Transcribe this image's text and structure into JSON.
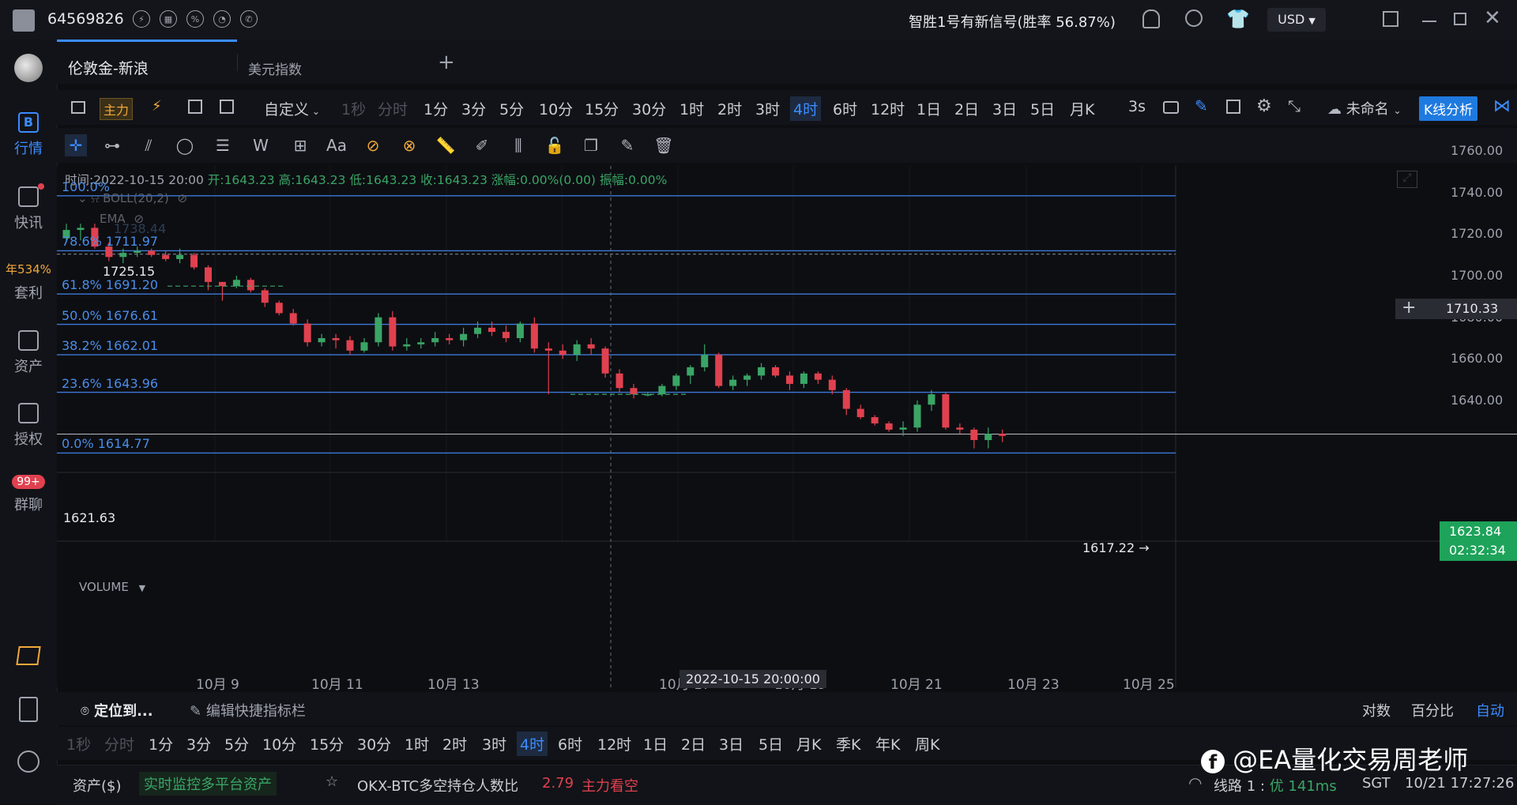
{
  "topbar": {
    "account_id": "64569826",
    "signal_text": "智胜1号有新信号(胜率 56.87%)",
    "currency": "USD"
  },
  "sidebar": {
    "items": [
      {
        "label": "行情",
        "icon": "b-icon"
      },
      {
        "label": "快讯",
        "icon": "news-icon"
      },
      {
        "label": "套利",
        "badge": "年534%"
      },
      {
        "label": "资产",
        "icon": "wallet-icon"
      },
      {
        "label": "授权",
        "icon": "key-icon"
      },
      {
        "label": "群聊",
        "badge": "99+"
      }
    ]
  },
  "tabs": [
    {
      "label": "伦敦金-新浪",
      "active": true
    },
    {
      "label": "美元指数",
      "active": false
    }
  ],
  "timeframe_bar": {
    "main_label": "主力",
    "custom_label": "自定义",
    "dim_items": [
      "1秒",
      "分时"
    ],
    "items": [
      "1分",
      "3分",
      "5分",
      "10分",
      "15分",
      "30分",
      "1时",
      "2时",
      "3时",
      "4时",
      "6时",
      "12时",
      "1日",
      "2日",
      "3日",
      "5日",
      "月K"
    ],
    "active": "4时",
    "refresh": "3s",
    "layout_name": "未命名",
    "kline_button": "K线分析"
  },
  "drawing_tools": {
    "text_tool": "Aa"
  },
  "chart_info": {
    "time": "时间:2022-10-15 20:00",
    "open": "开:1643.23",
    "high": "高:1643.23",
    "low": "低:1643.23",
    "close": "收:1643.23",
    "change": "涨幅:0.00%(0.00)",
    "amplitude": "振幅:0.00%",
    "boll": "BOLL(20,2)",
    "ema": "EMA",
    "volume": "VOLUME"
  },
  "chart_data": {
    "type": "candlestick",
    "symbol": "伦敦金-新浪",
    "interval": "4时",
    "y_ticks": [
      "1760.00",
      "1740.00",
      "1720.00",
      "1700.00",
      "1680.00",
      "1660.00",
      "1640.00"
    ],
    "ylim": [
      1605,
      1765
    ],
    "x_ticks": [
      "10月 9",
      "10月 11",
      "10月 13",
      "10月 17",
      "10月 19",
      "10月 21",
      "10月 23",
      "10月 25"
    ],
    "fib_levels": [
      {
        "label": "100.0%",
        "value": 1738.44
      },
      {
        "label": "78.6% 1711.97",
        "value": 1711.97
      },
      {
        "label": "61.8% 1691.20",
        "value": 1691.2
      },
      {
        "label": "50.0% 1676.61",
        "value": 1676.61
      },
      {
        "label": "38.2% 1662.01",
        "value": 1662.01
      },
      {
        "label": "23.6% 1643.96",
        "value": 1643.96
      },
      {
        "label": "0.0% 1614.77",
        "value": 1614.77
      }
    ],
    "fib_100_value_text": "1738.44",
    "annotations": {
      "high_label": "1725.15",
      "low_label": "1617.22 →",
      "left_price": "1621.63",
      "cursor_price": "1710.33",
      "last_price": "1623.84",
      "countdown": "02:32:34",
      "cursor_date": "2022-10-15 20:00:00"
    },
    "candles": [
      [
        1718,
        1725,
        1716,
        1722
      ],
      [
        1722,
        1725,
        1717,
        1723
      ],
      [
        1723,
        1725,
        1713,
        1714
      ],
      [
        1714,
        1716,
        1707,
        1709
      ],
      [
        1709,
        1713,
        1706,
        1711
      ],
      [
        1711,
        1714,
        1709,
        1712
      ],
      [
        1712,
        1713,
        1709,
        1710
      ],
      [
        1710,
        1712,
        1707,
        1708
      ],
      [
        1708,
        1713,
        1706,
        1710
      ],
      [
        1710,
        1711,
        1703,
        1704
      ],
      [
        1704,
        1705,
        1693,
        1697
      ],
      [
        1697,
        1697,
        1688,
        1695
      ],
      [
        1695,
        1700,
        1694,
        1698
      ],
      [
        1698,
        1699,
        1692,
        1693
      ],
      [
        1693,
        1694,
        1685,
        1687
      ],
      [
        1687,
        1688,
        1681,
        1682
      ],
      [
        1682,
        1684,
        1676,
        1677
      ],
      [
        1677,
        1679,
        1666,
        1668
      ],
      [
        1668,
        1672,
        1666,
        1670
      ],
      [
        1670,
        1672,
        1665,
        1669
      ],
      [
        1669,
        1671,
        1662,
        1664
      ],
      [
        1664,
        1670,
        1663,
        1668
      ],
      [
        1668,
        1682,
        1666,
        1680
      ],
      [
        1680,
        1683,
        1664,
        1666
      ],
      [
        1666,
        1670,
        1664,
        1667
      ],
      [
        1667,
        1670,
        1665,
        1668
      ],
      [
        1668,
        1673,
        1666,
        1670
      ],
      [
        1670,
        1672,
        1667,
        1669
      ],
      [
        1669,
        1675,
        1666,
        1672
      ],
      [
        1672,
        1678,
        1670,
        1675
      ],
      [
        1675,
        1678,
        1671,
        1673
      ],
      [
        1673,
        1676,
        1668,
        1670
      ],
      [
        1670,
        1678,
        1668,
        1677
      ],
      [
        1677,
        1680,
        1663,
        1665
      ],
      [
        1665,
        1668,
        1643,
        1664
      ],
      [
        1664,
        1667,
        1660,
        1662
      ],
      [
        1662,
        1669,
        1659,
        1667
      ],
      [
        1667,
        1670,
        1662,
        1665
      ],
      [
        1665,
        1666,
        1651,
        1653
      ],
      [
        1653,
        1655,
        1644,
        1646
      ],
      [
        1646,
        1648,
        1641,
        1643
      ],
      [
        1643,
        1644,
        1642,
        1643
      ],
      [
        1643,
        1648,
        1642,
        1647
      ],
      [
        1647,
        1653,
        1645,
        1652
      ],
      [
        1652,
        1657,
        1648,
        1656
      ],
      [
        1656,
        1667,
        1654,
        1662
      ],
      [
        1662,
        1663,
        1646,
        1647
      ],
      [
        1647,
        1652,
        1645,
        1650
      ],
      [
        1650,
        1653,
        1647,
        1652
      ],
      [
        1652,
        1658,
        1650,
        1656
      ],
      [
        1656,
        1657,
        1651,
        1652
      ],
      [
        1652,
        1654,
        1645,
        1648
      ],
      [
        1648,
        1654,
        1646,
        1653
      ],
      [
        1653,
        1654,
        1648,
        1650
      ],
      [
        1650,
        1652,
        1643,
        1645
      ],
      [
        1645,
        1646,
        1633,
        1636
      ],
      [
        1636,
        1638,
        1631,
        1632
      ],
      [
        1632,
        1633,
        1628,
        1629
      ],
      [
        1629,
        1630,
        1625,
        1626
      ],
      [
        1626,
        1630,
        1623,
        1627
      ],
      [
        1627,
        1640,
        1625,
        1638
      ],
      [
        1638,
        1645,
        1635,
        1643
      ],
      [
        1643,
        1644,
        1626,
        1627
      ],
      [
        1627,
        1629,
        1624,
        1626
      ],
      [
        1626,
        1627,
        1617,
        1621
      ],
      [
        1621,
        1627,
        1617,
        1624
      ],
      [
        1624,
        1626,
        1620,
        1623
      ]
    ]
  },
  "bottom_bar": {
    "locate": "定位到...",
    "edit_indicator": "编辑快捷指标栏",
    "log": "对数",
    "percent": "百分比",
    "auto": "自动",
    "dim_items": [
      "1秒",
      "分时"
    ],
    "items": [
      "1分",
      "3分",
      "5分",
      "10分",
      "15分",
      "30分",
      "1时",
      "2时",
      "3时",
      "4时",
      "6时",
      "12时",
      "1日",
      "2日",
      "3日",
      "5日",
      "月K",
      "季K",
      "年K",
      "周K"
    ],
    "active": "4时"
  },
  "status_bar": {
    "assets": "资产($)",
    "monitor": "实时监控多平台资产",
    "ratio_label": "OKX-BTC多空持仓人数比",
    "ratio_value": "2.79",
    "ratio_signal": "主力看空",
    "watermark": "@EA量化交易周老师",
    "line_label": "线路 1 :",
    "line_quality": "优 141ms",
    "timezone": "SGT",
    "datetime": "10/21 17:27:26"
  },
  "colors": {
    "up": "#3aa566",
    "down": "#e0414f",
    "fib": "#3d78d8",
    "accent": "#3b8cff"
  }
}
